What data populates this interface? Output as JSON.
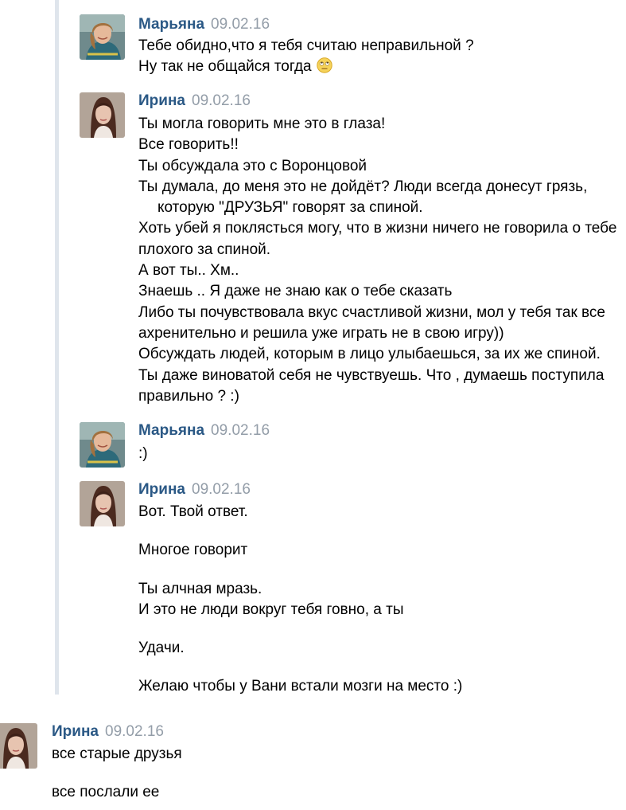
{
  "messages": [
    {
      "author": "Марьяна",
      "date": "09.02.16",
      "lines": [
        "Тебе обидно,что я тебя считаю неправильной ?",
        "Ну так не общайся тогда"
      ],
      "emoji": "rolling-eyes-emoji"
    },
    {
      "author": "Ирина",
      "date": "09.02.16",
      "lines": [
        "Ты могла говорить мне это в глаза!",
        "Все говорить!!",
        "Ты обсуждала это с Воронцовой",
        "Ты думала, до меня это не дойдёт? Люди всегда донесут грязь,",
        "которую \"ДРУЗЬЯ\" говорят за спиной.",
        "Хоть убей я поклясться могу, что в жизни ничего не говорила о тебе",
        "плохого за спиной.",
        "А вот ты.. Хм..",
        "Знаешь .. Я даже не знаю как о тебе сказать",
        "Либо ты почувствовала вкус счастливой жизни, мол у тебя так все",
        "ахренительно и решила уже играть не в свою игру))",
        "Обсуждать людей, которым в лицо улыбаешься, за их же спиной.",
        "Ты даже виноватой себя не чувствуешь. Что , думаешь поступила",
        "правильно ? :)"
      ]
    },
    {
      "author": "Марьяна",
      "date": "09.02.16",
      "lines": [
        ":)"
      ]
    },
    {
      "author": "Ирина",
      "date": "09.02.16",
      "lines": [
        "Вот. Твой ответ.",
        "Многое говорит",
        "Ты алчная мразь.",
        "И это не люди вокруг тебя говно, а ты",
        "Удачи.",
        "Желаю чтобы у Вани встали мозги на место :)"
      ]
    },
    {
      "author": "Ирина",
      "date": "09.02.16",
      "lines": [
        "все старые друзья",
        "все послали ее"
      ]
    }
  ]
}
